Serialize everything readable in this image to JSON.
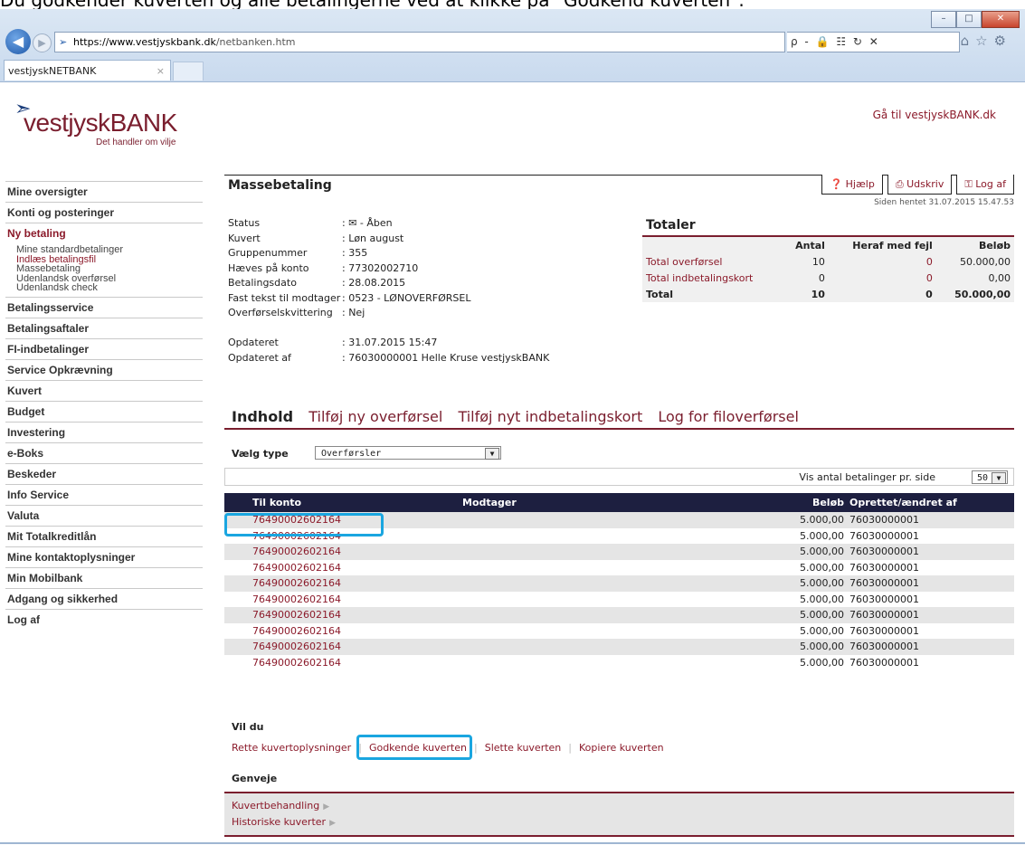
{
  "caption": "Du godkender kuverten og alle betalingerne ved at klikke på \"Godkend kuverten\".",
  "browser": {
    "url_prefix": "https://www.vestjyskbank.dk",
    "url_path": "/netbanken.htm",
    "addr_tools": "ρ - 🔒 ☷ ↻ ✕",
    "tab_title": "vestjyskNETBANK",
    "tab_close": "×",
    "win_min": "–",
    "win_max": "□",
    "win_close": "✕"
  },
  "logo": {
    "name": "vestjyskBANK",
    "tagline": "Det handler om vilje"
  },
  "top_link": "Gå til vestjyskBANK.dk",
  "sidebar": {
    "items": [
      {
        "label": "Mine oversigter"
      },
      {
        "label": "Konti og posteringer"
      },
      {
        "label": "Ny betaling"
      },
      {
        "label": "Betalingsservice"
      },
      {
        "label": "Betalingsaftaler"
      },
      {
        "label": "FI-indbetalinger"
      },
      {
        "label": "Service Opkrævning"
      },
      {
        "label": "Kuvert"
      },
      {
        "label": "Budget"
      },
      {
        "label": "Investering"
      },
      {
        "label": "e-Boks"
      },
      {
        "label": "Beskeder"
      },
      {
        "label": "Info Service"
      },
      {
        "label": "Valuta"
      },
      {
        "label": "Mit Totalkreditlån"
      },
      {
        "label": "Mine kontaktoplysninger"
      },
      {
        "label": "Min Mobilbank"
      },
      {
        "label": "Adgang og sikkerhed"
      },
      {
        "label": "Log af"
      }
    ],
    "subitems": [
      "Mine standardbetalinger",
      "Indlæs betalingsfil",
      "Massebetaling",
      "Udenlandsk overførsel",
      "Udenlandsk check"
    ]
  },
  "page": {
    "title": "Massebetaling",
    "help": "Hjælp",
    "print": "Udskriv",
    "logoff": "Log af",
    "fetched": "Siden hentet 31.07.2015 15.47.53"
  },
  "info": [
    {
      "k": "Status",
      "v": ": ✉ - Åben"
    },
    {
      "k": "Kuvert",
      "v": ": Løn august"
    },
    {
      "k": "Gruppenummer",
      "v": ": 355"
    },
    {
      "k": "Hæves på konto",
      "v": ": 77302002710"
    },
    {
      "k": "Betalingsdato",
      "v": ": 28.08.2015"
    },
    {
      "k": "Fast tekst til modtager",
      "v": ": 0523 - LØNOVERFØRSEL"
    },
    {
      "k": "Overførselskvittering",
      "v": ": Nej"
    },
    {
      "k": "",
      "v": ""
    },
    {
      "k": "Opdateret",
      "v": ": 31.07.2015 15:47"
    },
    {
      "k": "Opdateret af",
      "v": ": 76030000001 Helle Kruse vestjyskBANK"
    }
  ],
  "totals": {
    "title": "Totaler",
    "cols": [
      "",
      "Antal",
      "Heraf med fejl",
      "Beløb"
    ],
    "rows": [
      [
        "Total overførsel",
        "10",
        "0",
        "50.000,00"
      ],
      [
        "Total indbetalingskort",
        "0",
        "0",
        "0,00"
      ],
      [
        "Total",
        "10",
        "0",
        "50.000,00"
      ]
    ]
  },
  "tabs": [
    "Indhold",
    "Tilføj ny overførsel",
    "Tilføj nyt indbetalingskort",
    "Log for filoverførsel"
  ],
  "filter": {
    "label": "Vælg type",
    "value": "Overførsler",
    "per_page_label": "Vis antal betalinger pr. side",
    "per_page": "50"
  },
  "table": {
    "headers": [
      "Til konto",
      "Modtager",
      "Beløb",
      "Oprettet/ændret af"
    ],
    "rows": [
      [
        "76490002602164",
        "",
        "5.000,00",
        "76030000001"
      ],
      [
        "76490002602164",
        "",
        "5.000,00",
        "76030000001"
      ],
      [
        "76490002602164",
        "",
        "5.000,00",
        "76030000001"
      ],
      [
        "76490002602164",
        "",
        "5.000,00",
        "76030000001"
      ],
      [
        "76490002602164",
        "",
        "5.000,00",
        "76030000001"
      ],
      [
        "76490002602164",
        "",
        "5.000,00",
        "76030000001"
      ],
      [
        "76490002602164",
        "",
        "5.000,00",
        "76030000001"
      ],
      [
        "76490002602164",
        "",
        "5.000,00",
        "76030000001"
      ],
      [
        "76490002602164",
        "",
        "5.000,00",
        "76030000001"
      ],
      [
        "76490002602164",
        "",
        "5.000,00",
        "76030000001"
      ]
    ]
  },
  "vil_du": {
    "title": "Vil du",
    "actions": [
      "Rette kuvertoplysninger",
      "Godkende kuverten",
      "Slette kuverten",
      "Kopiere kuverten"
    ]
  },
  "genveje": {
    "title": "Genveje",
    "links": [
      "Kuvertbehandling",
      "Historiske kuverter"
    ]
  },
  "colors": {
    "brand": "#7a1e2e",
    "link": "#8b1a2a",
    "header_bg": "#1d1f40",
    "highlight": "#1aa6e0"
  }
}
